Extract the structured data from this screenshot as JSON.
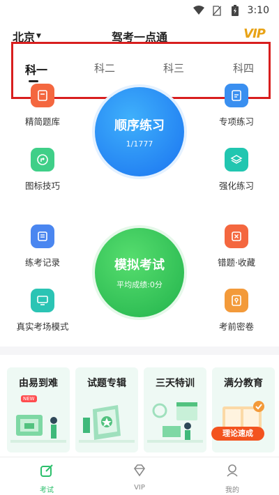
{
  "status_bar": {
    "time": "3:10",
    "icons": [
      "wifi-icon",
      "no-sim-icon",
      "battery-charging-icon"
    ]
  },
  "header": {
    "city": "北京",
    "title": "驾考一点通",
    "vip_logo": "VIP"
  },
  "tabs": [
    {
      "label": "科一",
      "active": true
    },
    {
      "label": "科二",
      "active": false
    },
    {
      "label": "科三",
      "active": false
    },
    {
      "label": "科四",
      "active": false
    }
  ],
  "features": {
    "concise_questions": "精简题库",
    "special_practice": "专项练习",
    "sign_tips": "图标技巧",
    "intensive_practice": "强化练习",
    "practice_record": "练考记录",
    "wrong_collection": "错题·收藏",
    "real_exam_mode": "真实考场模式",
    "pre_exam_paper": "考前密卷"
  },
  "sequential_practice": {
    "title": "顺序练习",
    "progress": "1/1777",
    "done": 1,
    "total": 1777
  },
  "mock_exam": {
    "title": "模拟考试",
    "avg_score": "平均成绩:0分"
  },
  "banners": [
    "由易到难",
    "试题专辑",
    "三天特训",
    "满分教育"
  ],
  "banner_badges": {
    "new": "NEW",
    "theory": "理论速成"
  },
  "bottom_nav": [
    {
      "label": "考试",
      "icon": "exam-edit-icon",
      "active": true
    },
    {
      "label": "VIP",
      "icon": "diamond-icon",
      "active": false
    },
    {
      "label": "我的",
      "icon": "profile-icon",
      "active": false
    }
  ],
  "colors": {
    "accent_green": "#2bbf6b",
    "highlight_red": "#d81e1e",
    "blue_circle": "#2f8ff5",
    "green_circle": "#34c65e"
  }
}
